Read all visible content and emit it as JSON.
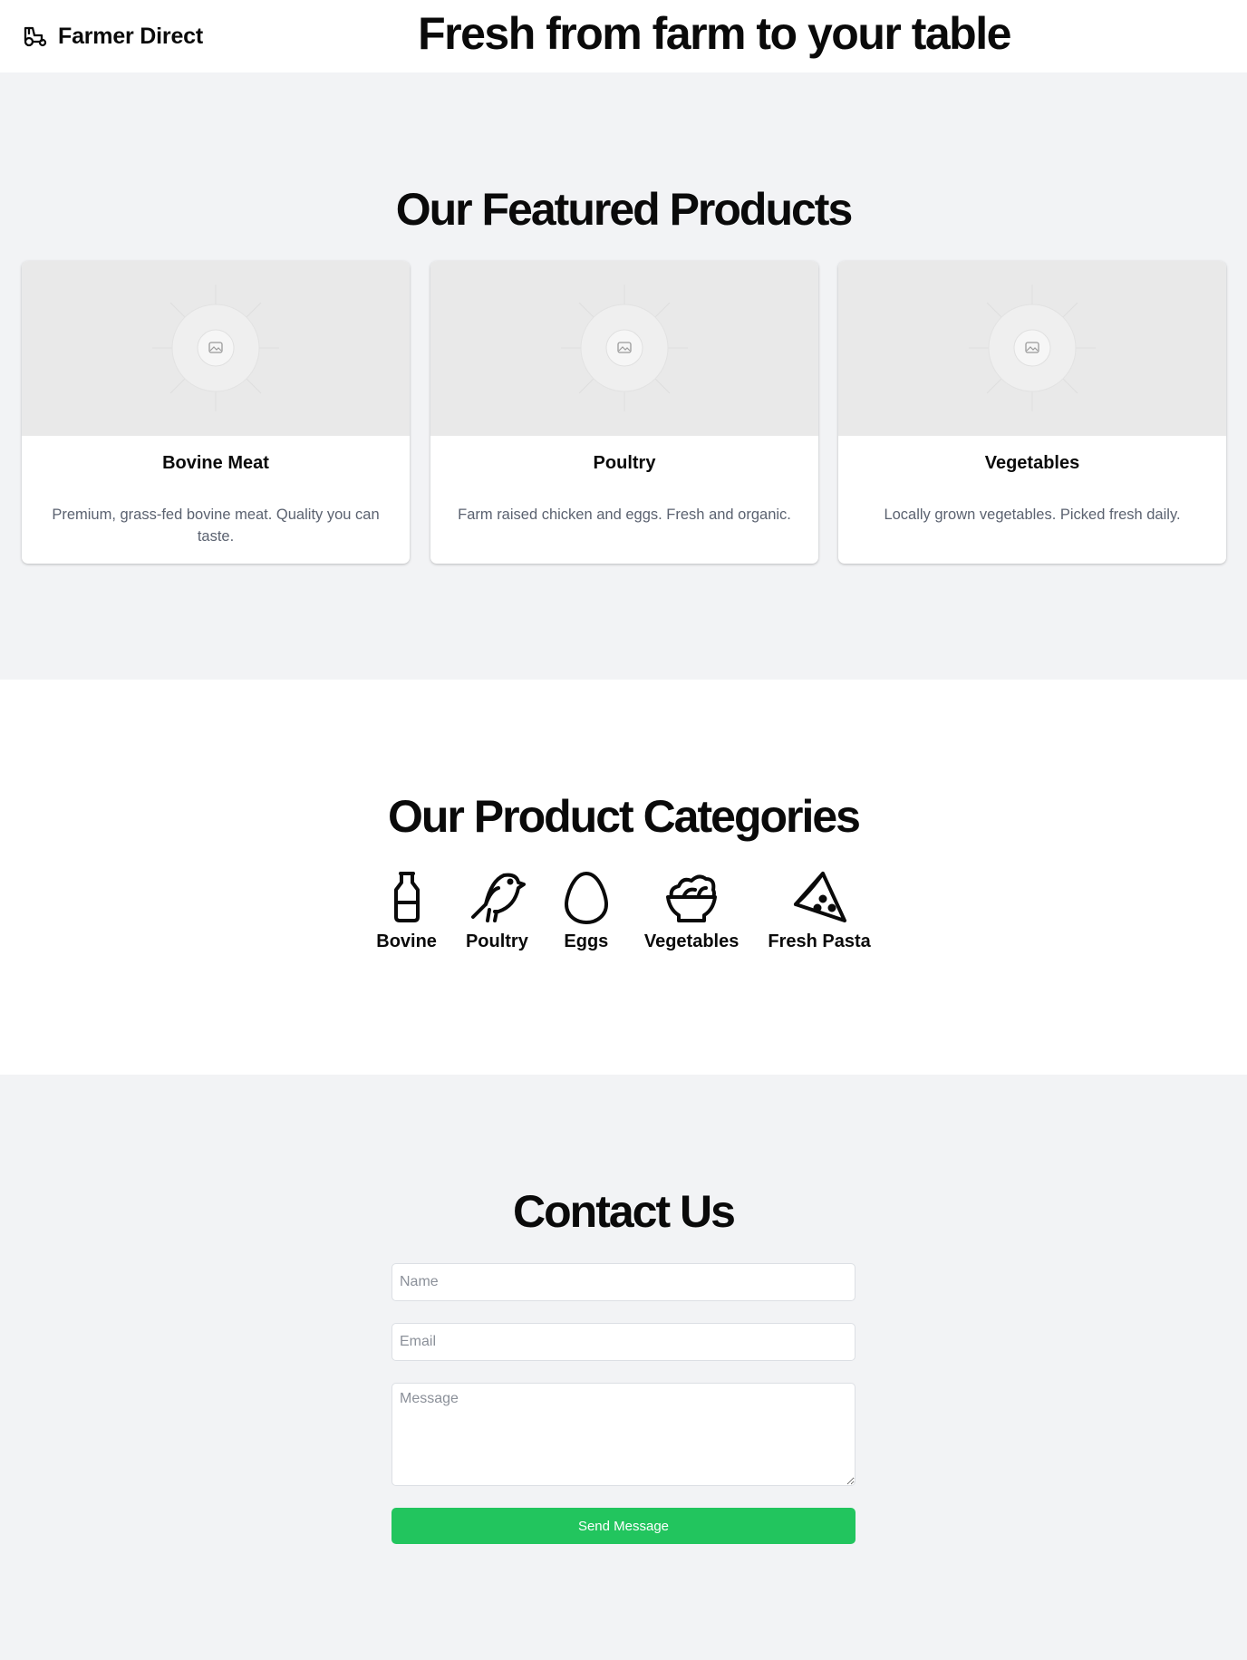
{
  "header": {
    "brand_name": "Farmer Direct",
    "brand_icon": "tractor-icon",
    "hero_title": "Fresh from farm to your table"
  },
  "featured": {
    "title": "Our Featured Products",
    "products": [
      {
        "title": "Bovine Meat",
        "description": "Premium, grass-fed bovine meat. Quality you can taste.",
        "image_icon": "image-placeholder-icon"
      },
      {
        "title": "Poultry",
        "description": "Farm raised chicken and eggs. Fresh and organic.",
        "image_icon": "image-placeholder-icon"
      },
      {
        "title": "Vegetables",
        "description": "Locally grown vegetables. Picked fresh daily.",
        "image_icon": "image-placeholder-icon"
      }
    ]
  },
  "categories": {
    "title": "Our Product Categories",
    "items": [
      {
        "label": "Bovine",
        "icon": "milk-bottle-icon"
      },
      {
        "label": "Poultry",
        "icon": "bird-icon"
      },
      {
        "label": "Eggs",
        "icon": "egg-icon"
      },
      {
        "label": "Vegetables",
        "icon": "salad-bowl-icon"
      },
      {
        "label": "Fresh Pasta",
        "icon": "pizza-slice-icon"
      }
    ]
  },
  "contact": {
    "title": "Contact Us",
    "name_placeholder": "Name",
    "email_placeholder": "Email",
    "message_placeholder": "Message",
    "submit_label": "Send Message"
  },
  "colors": {
    "accent": "#22c55e",
    "section_bg": "#f2f3f5",
    "muted_text": "#5b6270"
  }
}
